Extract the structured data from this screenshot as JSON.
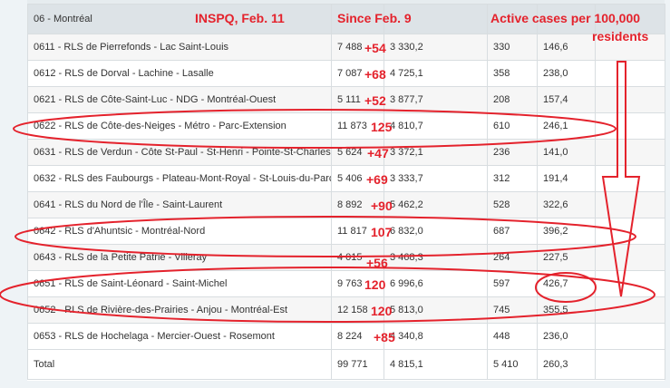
{
  "table": {
    "header_label": "06 - Montréal",
    "rows": [
      {
        "name": "0611 - RLS de Pierrefonds - Lac Saint-Louis",
        "cases": "7 488",
        "rate": "3 330,2",
        "active": "330",
        "active_rate": "146,6",
        "increase": "+54"
      },
      {
        "name": "0612 - RLS de Dorval - Lachine - Lasalle",
        "cases": "7 087",
        "rate": "4 725,1",
        "active": "358",
        "active_rate": "238,0",
        "increase": "+68"
      },
      {
        "name": "0621 - RLS de Côte-Saint-Luc - NDG - Montréal-Ouest",
        "cases": "5 111",
        "rate": "3 877,7",
        "active": "208",
        "active_rate": "157,4",
        "increase": "+52"
      },
      {
        "name": "0622 - RLS de Côte-des-Neiges - Métro - Parc-Extension",
        "cases": "11 873",
        "rate": "4 810,7",
        "active": "610",
        "active_rate": "246,1",
        "increase": "125"
      },
      {
        "name": "0631 - RLS de Verdun - Côte St-Paul - St-Henri - Pointe-St-Charles",
        "cases": "5 624",
        "rate": "3 372,1",
        "active": "236",
        "active_rate": "141,0",
        "increase": "+47"
      },
      {
        "name": "0632 - RLS des Faubourgs - Plateau-Mont-Royal - St-Louis-du-Parc",
        "cases": "5 406",
        "rate": "3 333,7",
        "active": "312",
        "active_rate": "191,4",
        "increase": "+69"
      },
      {
        "name": "0641 - RLS du Nord de l'Île - Saint-Laurent",
        "cases": "8 892",
        "rate": "5 462,2",
        "active": "528",
        "active_rate": "322,6",
        "increase": "+90"
      },
      {
        "name": "0642 - RLS d'Ahuntsic - Montréal-Nord",
        "cases": "11 817",
        "rate": "6 832,0",
        "active": "687",
        "active_rate": "396,2",
        "increase": "107"
      },
      {
        "name": "0643 - RLS de la Petite Patrie - Villeray",
        "cases": "4 015",
        "rate": "3 468,3",
        "active": "264",
        "active_rate": "227,5",
        "increase": "+56"
      },
      {
        "name": "0651 - RLS de Saint-Léonard - Saint-Michel",
        "cases": "9 763",
        "rate": "6 996,6",
        "active": "597",
        "active_rate": "426,7",
        "increase": "120"
      },
      {
        "name": "0652 - RLS de Rivière-des-Prairies - Anjou - Montréal-Est",
        "cases": "12 158",
        "rate": "5 813,0",
        "active": "745",
        "active_rate": "355,5",
        "increase": "120"
      },
      {
        "name": "0653 - RLS de Hochelaga - Mercier-Ouest - Rosemont",
        "cases": "8 224",
        "rate": "4 340,8",
        "active": "448",
        "active_rate": "236,0",
        "increase": "+85"
      }
    ],
    "total": {
      "label": "Total",
      "cases": "99 771",
      "rate": "4 815,1",
      "active": "5 410",
      "active_rate": "260,3"
    }
  },
  "annotations": {
    "source": "INSPQ, Feb. 11",
    "since": "Since Feb. 9",
    "active_line1": "Active cases per 100,000",
    "active_line2": "residents",
    "color": "#e4222c"
  }
}
